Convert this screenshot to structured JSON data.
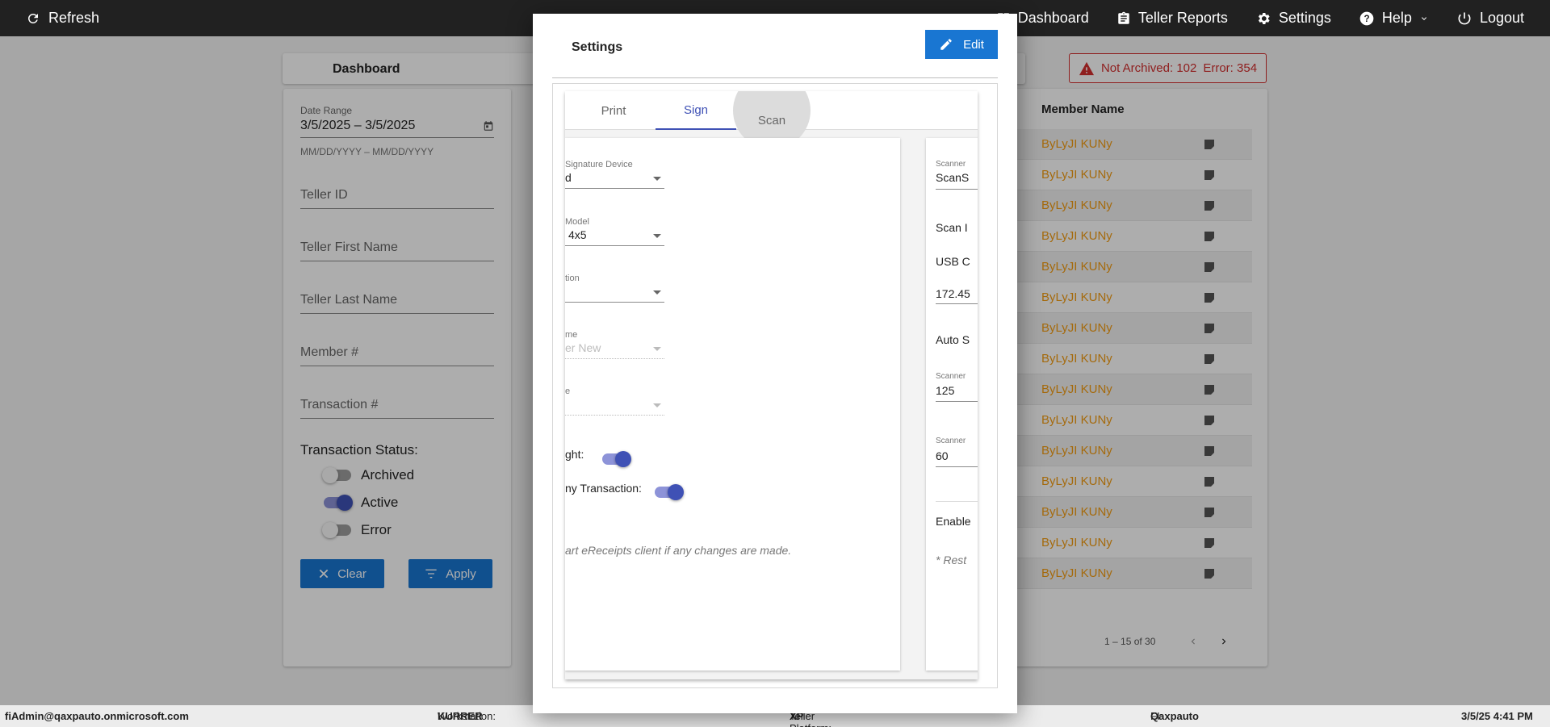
{
  "topbar": {
    "refresh_label": "Refresh",
    "dashboard_label": "Dashboard",
    "reports_label": "Teller Reports",
    "settings_label": "Settings",
    "help_label": "Help",
    "logout_label": "Logout"
  },
  "dashboard": {
    "title": "Dashboard",
    "badge": {
      "not_archived": "Not Archived: 102",
      "error": "Error: 354"
    },
    "filters": {
      "date_range_label": "Date Range",
      "date_range_value": "3/5/2025 – 3/5/2025",
      "date_hint": "MM/DD/YYYY – MM/DD/YYYY",
      "teller_id": "Teller ID",
      "teller_first": "Teller First Name",
      "teller_last": "Teller Last Name",
      "member": "Member #",
      "transaction": "Transaction #",
      "status_title": "Transaction Status:",
      "status_archived": "Archived",
      "status_active": "Active",
      "status_error": "Error",
      "clear_label": "Clear",
      "apply_label": "Apply"
    },
    "table": {
      "col_member_name": "Member Name",
      "rows": [
        "ByLyJI KUNy",
        "ByLyJI KUNy",
        "ByLyJI KUNy",
        "ByLyJI KUNy",
        "ByLyJI KUNy",
        "ByLyJI KUNy",
        "ByLyJI KUNy",
        "ByLyJI KUNy",
        "ByLyJI KUNy",
        "ByLyJI KUNy",
        "ByLyJI KUNy",
        "ByLyJI KUNy",
        "ByLyJI KUNy",
        "ByLyJI KUNy",
        "ByLyJI KUNy"
      ],
      "pager_text": "1 – 15 of 30"
    }
  },
  "modal": {
    "title": "Settings",
    "edit_label": "Edit",
    "tabs": {
      "print": "Print",
      "sign": "Sign",
      "scan": "Scan"
    },
    "left_panel": {
      "device_label": "Signature Device",
      "device_value": "d",
      "model_label": "Model",
      "model_value": "4x5",
      "loc_label": "tion",
      "loc_value": "",
      "name_label": "me",
      "name_value": "er New",
      "e_label": "e",
      "e_value": "",
      "toggle1_label": "ght:",
      "toggle2_label": "ny Transaction:",
      "note": "art eReceipts client if any changes are made."
    },
    "right_panel": {
      "scanner_label": "Scanner",
      "scanner_value": "ScanS",
      "scan_text": "Scan I",
      "usb_text": "USB C",
      "ip_value": "172.45",
      "auto_text": "Auto S",
      "scanner2_label": "Scanner",
      "scanner2_value": "125",
      "scanner3_label": "Scanner",
      "scanner3_value": "60",
      "enable_text": "Enable",
      "rest_text": "* Rest"
    }
  },
  "footer": {
    "user": "fiAdmin@qaxpauto.onmicrosoft.com",
    "workstation_label": "Workstation:",
    "workstation_value": "KURRER",
    "platform_label": "Teller Platform:",
    "platform_value": "XP",
    "fi_label": "FI:",
    "fi_value": "Qaxpauto",
    "datetime": "3/5/25 4:41 PM"
  }
}
